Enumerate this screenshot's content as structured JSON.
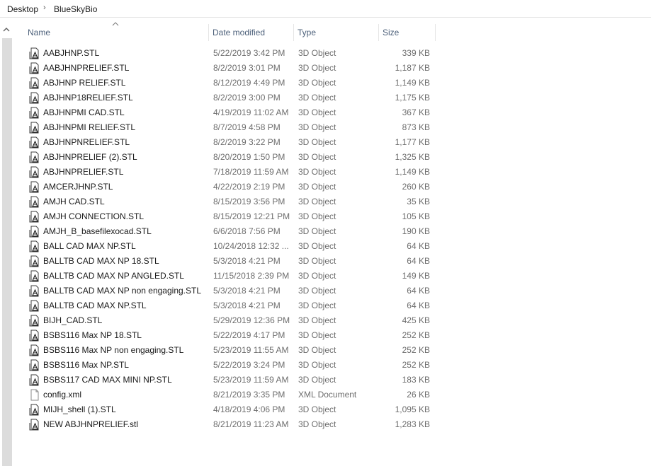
{
  "breadcrumb": {
    "items": [
      "Desktop",
      "BlueSkyBio"
    ],
    "separator": "›"
  },
  "columns": {
    "name": "Name",
    "date": "Date modified",
    "type": "Type",
    "size": "Size"
  },
  "files": [
    {
      "name": "AABJHNP.STL",
      "date": "5/22/2019 3:42 PM",
      "type": "3D Object",
      "size": "339 KB",
      "icon": "stl-file-icon"
    },
    {
      "name": "AABJHNPRELIEF.STL",
      "date": "8/2/2019 3:01 PM",
      "type": "3D Object",
      "size": "1,187 KB",
      "icon": "stl-file-icon"
    },
    {
      "name": "ABJHNP RELIEF.STL",
      "date": "8/12/2019 4:49 PM",
      "type": "3D Object",
      "size": "1,149 KB",
      "icon": "stl-file-icon"
    },
    {
      "name": "ABJHNP18RELIEF.STL",
      "date": "8/2/2019 3:00 PM",
      "type": "3D Object",
      "size": "1,175 KB",
      "icon": "stl-file-icon"
    },
    {
      "name": "ABJHNPMI CAD.STL",
      "date": "4/19/2019 11:02 AM",
      "type": "3D Object",
      "size": "367 KB",
      "icon": "stl-file-icon"
    },
    {
      "name": "ABJHNPMI RELIEF.STL",
      "date": "8/7/2019 4:58 PM",
      "type": "3D Object",
      "size": "873 KB",
      "icon": "stl-file-icon"
    },
    {
      "name": "ABJHNPNRELIEF.STL",
      "date": "8/2/2019 3:22 PM",
      "type": "3D Object",
      "size": "1,177 KB",
      "icon": "stl-file-icon"
    },
    {
      "name": "ABJHNPRELIEF (2).STL",
      "date": "8/20/2019 1:50 PM",
      "type": "3D Object",
      "size": "1,325 KB",
      "icon": "stl-file-icon"
    },
    {
      "name": "ABJHNPRELIEF.STL",
      "date": "7/18/2019 11:59 AM",
      "type": "3D Object",
      "size": "1,149 KB",
      "icon": "stl-file-icon"
    },
    {
      "name": "AMCERJHNP.STL",
      "date": "4/22/2019 2:19 PM",
      "type": "3D Object",
      "size": "260 KB",
      "icon": "stl-file-icon"
    },
    {
      "name": "AMJH CAD.STL",
      "date": "8/15/2019 3:56 PM",
      "type": "3D Object",
      "size": "35 KB",
      "icon": "stl-file-icon"
    },
    {
      "name": "AMJH CONNECTION.STL",
      "date": "8/15/2019 12:21 PM",
      "type": "3D Object",
      "size": "105 KB",
      "icon": "stl-file-icon"
    },
    {
      "name": "AMJH_B_basefilexocad.STL",
      "date": "6/6/2018 7:56 PM",
      "type": "3D Object",
      "size": "190 KB",
      "icon": "stl-file-icon"
    },
    {
      "name": "BALL CAD MAX NP.STL",
      "date": "10/24/2018 12:32 ...",
      "type": "3D Object",
      "size": "64 KB",
      "icon": "stl-file-icon"
    },
    {
      "name": "BALLTB CAD MAX NP 18.STL",
      "date": "5/3/2018 4:21 PM",
      "type": "3D Object",
      "size": "64 KB",
      "icon": "stl-file-icon"
    },
    {
      "name": "BALLTB CAD MAX NP ANGLED.STL",
      "date": "11/15/2018 2:39 PM",
      "type": "3D Object",
      "size": "149 KB",
      "icon": "stl-file-icon"
    },
    {
      "name": "BALLTB CAD MAX NP non engaging.STL",
      "date": "5/3/2018 4:21 PM",
      "type": "3D Object",
      "size": "64 KB",
      "icon": "stl-file-icon"
    },
    {
      "name": "BALLTB CAD MAX NP.STL",
      "date": "5/3/2018 4:21 PM",
      "type": "3D Object",
      "size": "64 KB",
      "icon": "stl-file-icon"
    },
    {
      "name": "BIJH_CAD.STL",
      "date": "5/29/2019 12:36 PM",
      "type": "3D Object",
      "size": "425 KB",
      "icon": "stl-file-icon"
    },
    {
      "name": "BSBS116 Max NP 18.STL",
      "date": "5/22/2019 4:17 PM",
      "type": "3D Object",
      "size": "252 KB",
      "icon": "stl-file-icon"
    },
    {
      "name": "BSBS116 Max NP non engaging.STL",
      "date": "5/23/2019 11:55 AM",
      "type": "3D Object",
      "size": "252 KB",
      "icon": "stl-file-icon"
    },
    {
      "name": "BSBS116 Max NP.STL",
      "date": "5/22/2019 3:24 PM",
      "type": "3D Object",
      "size": "252 KB",
      "icon": "stl-file-icon"
    },
    {
      "name": "BSBS117 CAD MAX MINI NP.STL",
      "date": "5/23/2019 11:59 AM",
      "type": "3D Object",
      "size": "183 KB",
      "icon": "stl-file-icon"
    },
    {
      "name": "config.xml",
      "date": "8/21/2019 3:35 PM",
      "type": "XML Document",
      "size": "26 KB",
      "icon": "xml-file-icon"
    },
    {
      "name": "MIJH_shell (1).STL",
      "date": "4/18/2019 4:06 PM",
      "type": "3D Object",
      "size": "1,095 KB",
      "icon": "stl-file-icon"
    },
    {
      "name": "NEW ABJHNPRELIEF.stl",
      "date": "8/21/2019 11:23 AM",
      "type": "3D Object",
      "size": "1,283 KB",
      "icon": "stl-file-icon"
    }
  ]
}
